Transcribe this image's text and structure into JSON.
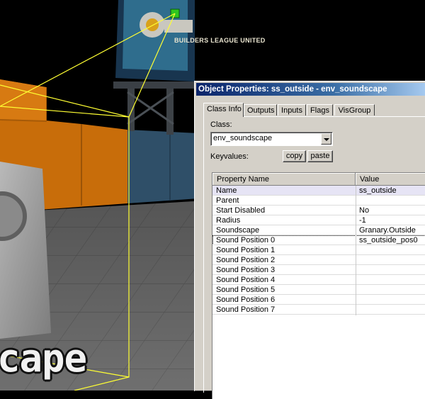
{
  "viewport": {
    "overlay_text": "cape",
    "billboard_text": "BUILDERS LEAGUE UNITED"
  },
  "dialog": {
    "title": "Object Properties: ss_outside - env_soundscape",
    "tabs": [
      "Class Info",
      "Outputs",
      "Inputs",
      "Flags",
      "VisGroup"
    ],
    "active_tab": "Class Info",
    "class_label": "Class:",
    "class_value": "env_soundscape",
    "keyvalues_label": "Keyvalues:",
    "copy_label": "copy",
    "paste_label": "paste",
    "grid": {
      "headers": [
        "Property Name",
        "Value"
      ],
      "rows": [
        {
          "name": "Name",
          "value": "ss_outside"
        },
        {
          "name": "Parent",
          "value": ""
        },
        {
          "name": "Start Disabled",
          "value": "No"
        },
        {
          "name": "Radius",
          "value": "-1"
        },
        {
          "name": "Soundscape",
          "value": "Granary.Outside"
        },
        {
          "name": "Sound Position 0",
          "value": "ss_outside_pos0"
        },
        {
          "name": "Sound Position 1",
          "value": ""
        },
        {
          "name": "Sound Position 2",
          "value": ""
        },
        {
          "name": "Sound Position 3",
          "value": ""
        },
        {
          "name": "Sound Position 4",
          "value": ""
        },
        {
          "name": "Sound Position 5",
          "value": ""
        },
        {
          "name": "Sound Position 6",
          "value": ""
        },
        {
          "name": "Sound Position 7",
          "value": ""
        }
      ],
      "selected_row": "Sound Position 0"
    }
  }
}
